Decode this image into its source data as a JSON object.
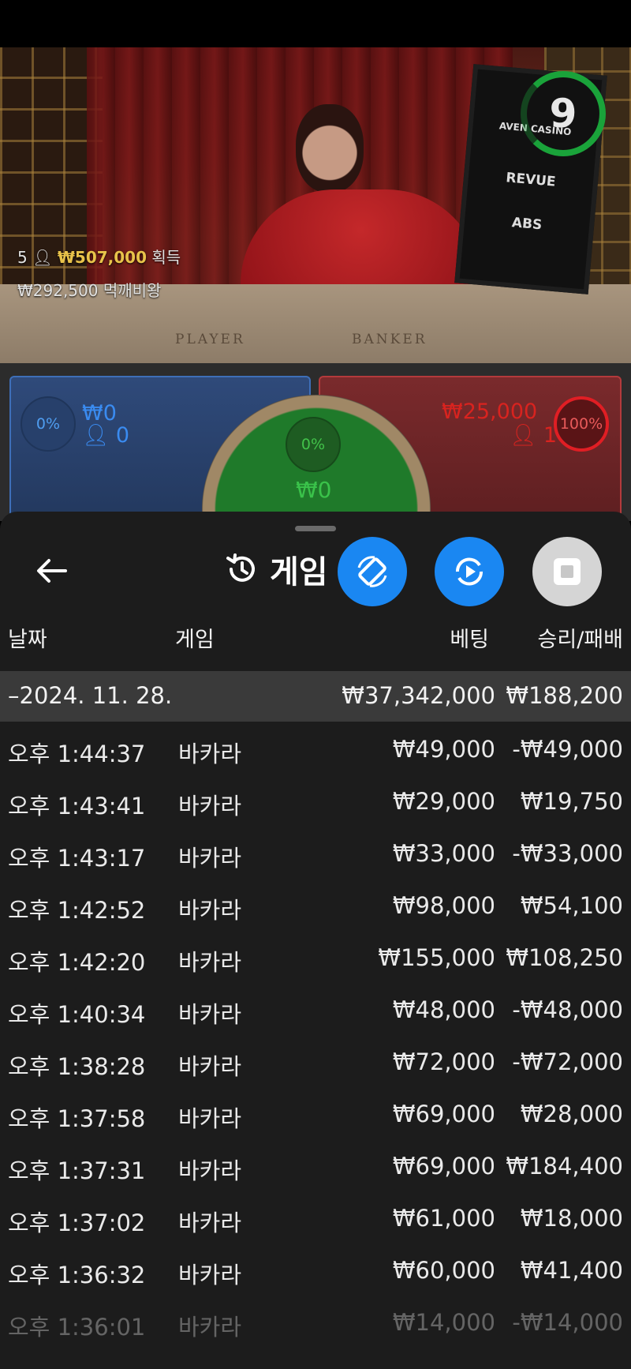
{
  "video": {
    "timer": "9",
    "screen_brands": [
      "AVEN CASINO",
      "REVUE",
      "ABS"
    ],
    "table_labels": {
      "player": "PLAYER",
      "banker": "BANKER"
    },
    "winners": {
      "count": "5",
      "amount": "₩507,000",
      "suffix": "획득",
      "line2_amount": "₩292,500",
      "line2_name": "먹깨비왕"
    }
  },
  "bets": {
    "player": {
      "percent": "0%",
      "amount": "₩0",
      "players": "0"
    },
    "banker": {
      "percent": "100%",
      "amount": "₩25,000",
      "players": "1"
    },
    "tie": {
      "percent": "0%",
      "amount": "₩0"
    }
  },
  "sheet": {
    "title": "게임 기록",
    "back_icon": "arrow-left-icon",
    "history_icon": "history-icon",
    "fabs": [
      "rotate-icon",
      "replay-icon",
      "stop-icon"
    ],
    "columns": {
      "date": "날짜",
      "game": "게임",
      "bet": "베팅",
      "winloss": "승리/패배"
    },
    "group": {
      "date": "–2024. 11. 28.",
      "bet_total": "₩37,342,000",
      "winloss_total": "₩188,200"
    },
    "rows": [
      {
        "time": "오후 1:44:37",
        "game": "바카라",
        "bet": "₩49,000",
        "winloss": "-₩49,000"
      },
      {
        "time": "오후 1:43:41",
        "game": "바카라",
        "bet": "₩29,000",
        "winloss": "₩19,750"
      },
      {
        "time": "오후 1:43:17",
        "game": "바카라",
        "bet": "₩33,000",
        "winloss": "-₩33,000"
      },
      {
        "time": "오후 1:42:52",
        "game": "바카라",
        "bet": "₩98,000",
        "winloss": "₩54,100"
      },
      {
        "time": "오후 1:42:20",
        "game": "바카라",
        "bet": "₩155,000",
        "winloss": "₩108,250"
      },
      {
        "time": "오후 1:40:34",
        "game": "바카라",
        "bet": "₩48,000",
        "winloss": "-₩48,000"
      },
      {
        "time": "오후 1:38:28",
        "game": "바카라",
        "bet": "₩72,000",
        "winloss": "-₩72,000"
      },
      {
        "time": "오후 1:37:58",
        "game": "바카라",
        "bet": "₩69,000",
        "winloss": "₩28,000"
      },
      {
        "time": "오후 1:37:31",
        "game": "바카라",
        "bet": "₩69,000",
        "winloss": "₩184,400"
      },
      {
        "time": "오후 1:37:02",
        "game": "바카라",
        "bet": "₩61,000",
        "winloss": "₩18,000"
      },
      {
        "time": "오후 1:36:32",
        "game": "바카라",
        "bet": "₩60,000",
        "winloss": "₩41,400"
      },
      {
        "time": "오후 1:36:01",
        "game": "바카라",
        "bet": "₩14,000",
        "winloss": "-₩14,000"
      }
    ]
  }
}
